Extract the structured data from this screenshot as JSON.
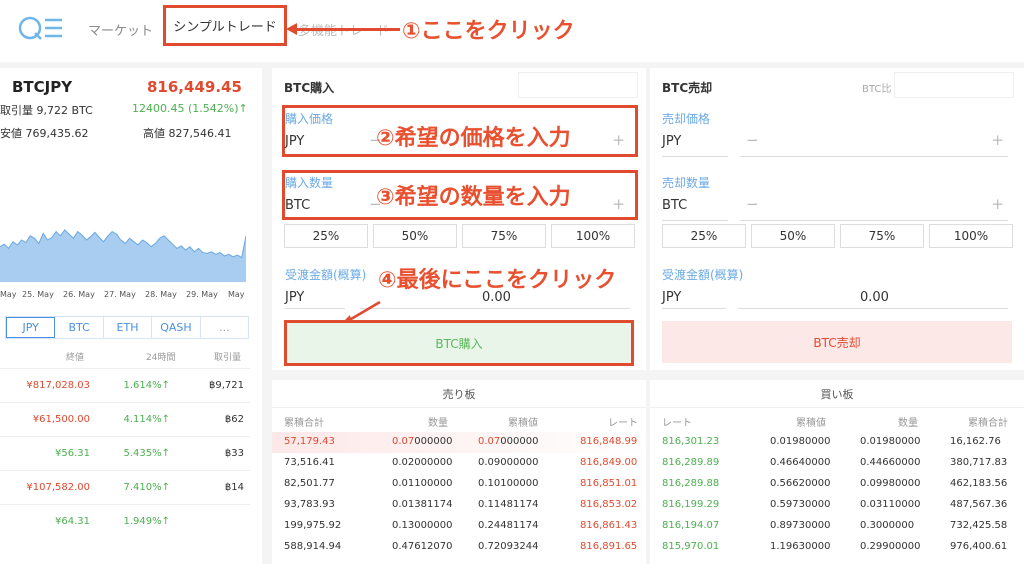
{
  "header": {
    "nav_market": "マーケット",
    "nav_simple": "シンプルトレード",
    "nav_multi": "多機能トレード"
  },
  "annotations": {
    "a1": "①ここをクリック",
    "a2": "②希望の価格を入力",
    "a3": "③希望の数量を入力",
    "a4": "④最後にここをクリック"
  },
  "ticker": {
    "pair": "BTCJPY",
    "price": "816,449.45",
    "volume": "取引量 9,722 BTC",
    "change": "12400.45 (1.542%)↑",
    "low": "安値 769,435.62",
    "high": "高値 827,546.41"
  },
  "chart_dates": [
    "May",
    "25. May",
    "26. May",
    "27. May",
    "28. May",
    "29. May",
    "May"
  ],
  "chart_data": {
    "type": "area",
    "values": [
      0.42,
      0.45,
      0.4,
      0.48,
      0.44,
      0.5,
      0.47,
      0.55,
      0.52,
      0.46,
      0.58,
      0.5,
      0.53,
      0.6,
      0.55,
      0.62,
      0.57,
      0.52,
      0.6,
      0.56,
      0.5,
      0.54,
      0.59,
      0.53,
      0.48,
      0.55,
      0.6,
      0.57,
      0.5,
      0.46,
      0.52,
      0.48,
      0.44,
      0.5,
      0.47,
      0.42,
      0.46,
      0.52,
      0.55,
      0.5,
      0.45,
      0.4,
      0.43,
      0.38,
      0.42,
      0.36,
      0.4,
      0.35,
      0.34,
      0.36,
      0.33,
      0.35,
      0.31,
      0.33,
      0.3,
      0.32,
      0.29,
      0.55
    ],
    "color": "#a8cdf0"
  },
  "currency_tabs": [
    "JPY",
    "BTC",
    "ETH",
    "QASH",
    "..."
  ],
  "market_head": {
    "close": "終値",
    "day": "24時間",
    "volume": "取引量"
  },
  "markets": [
    {
      "price": "¥817,028.03",
      "pct": "1.614%↑",
      "vol": "฿9,721",
      "up": false
    },
    {
      "price": "¥61,500.00",
      "pct": "4.114%↑",
      "vol": "฿62",
      "up": false
    },
    {
      "price": "¥56.31",
      "pct": "5.435%↑",
      "vol": "฿33",
      "up": true
    },
    {
      "price": "¥107,582.00",
      "pct": "7.410%↑",
      "vol": "฿14",
      "up": false
    },
    {
      "price": "¥64.31",
      "pct": "1.949%↑",
      "vol": "",
      "up": true
    }
  ],
  "buy": {
    "title": "BTC購入",
    "price_label": "購入価格",
    "qty_label": "購入数量",
    "unit_price": "JPY",
    "unit_qty": "BTC",
    "pcts": [
      "25%",
      "50%",
      "75%",
      "100%"
    ],
    "est_label": "受渡金額(概算)",
    "est_unit": "JPY",
    "est_value": "0.00",
    "button": "BTC購入"
  },
  "sell": {
    "title": "BTC売却",
    "side_label": "BTC比",
    "price_label": "売却価格",
    "qty_label": "売却数量",
    "unit_price": "JPY",
    "unit_qty": "BTC",
    "pcts": [
      "25%",
      "50%",
      "75%",
      "100%"
    ],
    "est_label": "受渡金額(概算)",
    "est_unit": "JPY",
    "est_value": "0.00",
    "button": "BTC売却"
  },
  "ask_book": {
    "title": "売り板",
    "head": [
      "累積合計",
      "数量",
      "累積値",
      "レート"
    ],
    "rows": [
      [
        "57,179.43",
        "0.07",
        "000000",
        "0.07",
        "000000",
        "816,848.99"
      ],
      [
        "73,516.41",
        "0.02",
        "000000",
        "0.09",
        "000000",
        "816,849.00"
      ],
      [
        "82,501.77",
        "0.011",
        "00000",
        "0.101",
        "00000",
        "816,851.01"
      ],
      [
        "93,783.93",
        "0.01381174",
        "",
        "0.11481174",
        "",
        "816,853.02"
      ],
      [
        "199,975.92",
        "0.13",
        "000000",
        "0.24481174",
        "",
        "816,861.43"
      ],
      [
        "588,914.94",
        "0.47612070",
        "",
        "0.72093244",
        "",
        "816,891.65"
      ]
    ]
  },
  "bid_book": {
    "title": "買い板",
    "head": [
      "レート",
      "累積値",
      "数量",
      "累積合計"
    ],
    "rows": [
      [
        "816,301.23",
        "0.0198",
        "0000",
        "0.0198",
        "0000",
        "16,162.76"
      ],
      [
        "816,289.89",
        "0.4664",
        "0000",
        "0.4466",
        "0000",
        "380,717.83"
      ],
      [
        "816,289.88",
        "0.5662",
        "0000",
        "0.0998",
        "0000",
        "462,183.56"
      ],
      [
        "816,199.29",
        "0.5973",
        "0000",
        "0.0311",
        "0000",
        "487,567.36"
      ],
      [
        "816,194.07",
        "0.8973",
        "0000",
        "0.3",
        "000000",
        "732,425.58"
      ],
      [
        "815,970.01",
        "1.1963",
        "0000",
        "0.299",
        "00000",
        "976,400.61"
      ]
    ]
  }
}
